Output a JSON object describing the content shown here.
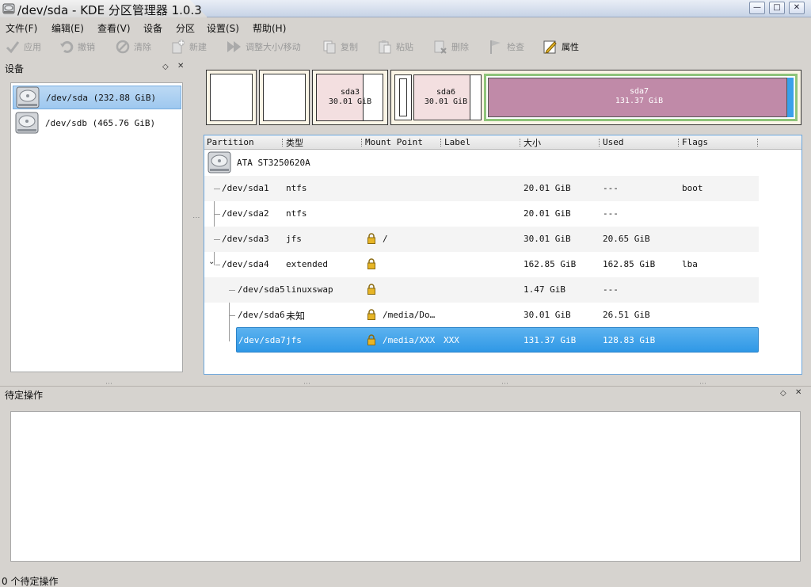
{
  "window": {
    "title": "/dev/sda - KDE 分区管理器 1.0.3",
    "buttons": [
      "—",
      "□",
      "✕"
    ]
  },
  "menubar": [
    {
      "label": "文件(F)"
    },
    {
      "label": "编辑(E)"
    },
    {
      "label": "查看(V)"
    },
    {
      "label": "设备"
    },
    {
      "label": "分区"
    },
    {
      "label": "设置(S)"
    },
    {
      "label": "帮助(H)"
    }
  ],
  "toolbar": {
    "apply": "应用",
    "undo": "撤销",
    "clear": "清除",
    "new": "新建",
    "resize": "调整大小/移动",
    "copy": "复制",
    "paste": "粘贴",
    "delete": "删除",
    "check": "检查",
    "properties": "属性"
  },
  "devices_dock": {
    "title": "设备",
    "devices": [
      {
        "name": "/dev/sda (232.88 GiB)",
        "selected": true
      },
      {
        "name": "/dev/sdb (465.76 GiB)",
        "selected": false
      }
    ]
  },
  "partition_bar": {
    "sda3": {
      "name": "sda3",
      "size": "30.01 GiB"
    },
    "sda6": {
      "name": "sda6",
      "size": "30.01 GiB"
    },
    "sda7": {
      "name": "sda7",
      "size": "131.37 GiB"
    }
  },
  "table": {
    "headers": {
      "partition": "Partition",
      "type": "类型",
      "mount": "Mount Point",
      "label": "Label",
      "size": "大小",
      "used": "Used",
      "flags": "Flags"
    },
    "disk": "ATA ST3250620A",
    "rows": [
      {
        "partition": "/dev/sda1",
        "type": "ntfs",
        "mount": "",
        "label": "",
        "size": "20.01 GiB",
        "used": "---",
        "flags": "boot"
      },
      {
        "partition": "/dev/sda2",
        "type": "ntfs",
        "mount": "",
        "label": "",
        "size": "20.01 GiB",
        "used": "---",
        "flags": ""
      },
      {
        "partition": "/dev/sda3",
        "type": "jfs",
        "mount": "/",
        "label": "",
        "size": "30.01 GiB",
        "used": "20.65 GiB",
        "flags": ""
      },
      {
        "partition": "/dev/sda4",
        "type": "extended",
        "mount": "",
        "label": "",
        "size": "162.85 GiB",
        "used": "162.85 GiB",
        "flags": "lba"
      },
      {
        "partition": "/dev/sda5",
        "type": "linuxswap",
        "mount": "",
        "label": "",
        "size": "1.47 GiB",
        "used": "---",
        "flags": ""
      },
      {
        "partition": "/dev/sda6",
        "type": "未知",
        "mount": "/media/Do…",
        "label": "",
        "size": "30.01 GiB",
        "used": "26.51 GiB",
        "flags": ""
      },
      {
        "partition": "/dev/sda7",
        "type": "jfs",
        "mount": "/media/XXX",
        "label": "XXX",
        "size": "131.37 GiB",
        "used": "128.83 GiB",
        "flags": ""
      }
    ]
  },
  "pending_dock": {
    "title": "待定操作"
  },
  "status": {
    "text": "0 个待定操作"
  },
  "colors": {
    "selection": "#3aa0ea",
    "partition_fill": "#c08aa8",
    "extended_border": "#8ec47a"
  }
}
